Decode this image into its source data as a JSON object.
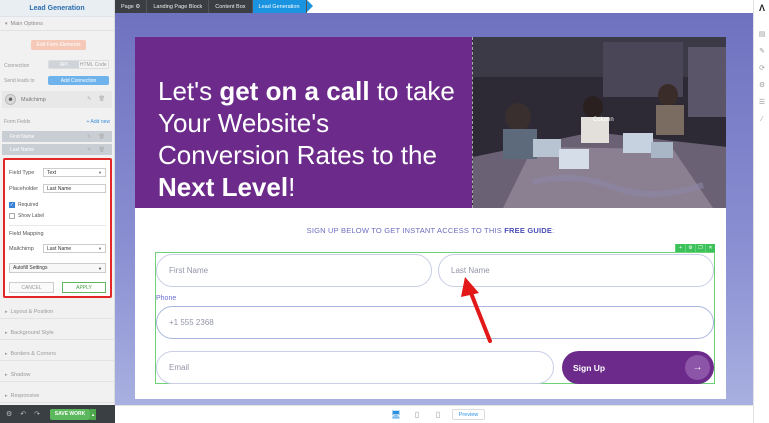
{
  "left_panel": {
    "title": "Lead Generation",
    "main_options": "Main Options",
    "edit_form_elements": "Edit Form Elements",
    "connection_label": "Connection",
    "connection_api": "API",
    "connection_html": "HTML Code",
    "send_leads_label": "Send leads to",
    "add_connection": "Add Connection",
    "integration_name": "Mailchimp",
    "form_fields_label": "Form Fields",
    "add_new": "+ Add new",
    "fields": [
      "First Name",
      "Last Name"
    ],
    "field_panel": {
      "field_type_label": "Field Type",
      "field_type_value": "Text",
      "placeholder_label": "Placeholder",
      "placeholder_value": "Last Name",
      "required_label": "Required",
      "show_label_label": "Show Label",
      "field_mapping_label": "Field Mapping",
      "mapping_service": "Mailchimp",
      "mapping_value": "Last Name",
      "autofill": "Autofill Settings",
      "cancel": "CANCEL",
      "apply": "APPLY"
    },
    "sections": [
      "Layout & Position",
      "Background Style",
      "Borders & Corners",
      "Shadow",
      "Responsive"
    ],
    "save_work": "SAVE WORK"
  },
  "breadcrumb": [
    "Page",
    "Landing Page Block",
    "Content Box",
    "Lead Generation"
  ],
  "canvas": {
    "hero_heading_1": "Let's ",
    "hero_heading_bold_1": "get on a call",
    "hero_heading_2": " to take Your Website's Conversion Rates to the ",
    "hero_heading_bold_2": "Next Level",
    "hero_heading_3": "!",
    "column_label": "Column",
    "signup_text": "SIGN UP BELOW TO GET INSTANT ACCESS TO THIS ",
    "signup_text_bold": "FREE GUIDE",
    "signup_text_end": ":",
    "form": {
      "first_name_placeholder": "First Name",
      "last_name_placeholder": "Last Name",
      "phone_label": "Phone",
      "phone_placeholder": "+1 555 2368",
      "email_placeholder": "Email",
      "signup_button": "Sign Up",
      "signup_arrow": "→"
    }
  },
  "device_bar": {
    "preview": "Preview"
  },
  "colors": {
    "hero_purple": "#6c2b8a",
    "accent_blue": "#1a94e0",
    "save_green": "#5cb85c",
    "highlight_red": "#e32626"
  }
}
